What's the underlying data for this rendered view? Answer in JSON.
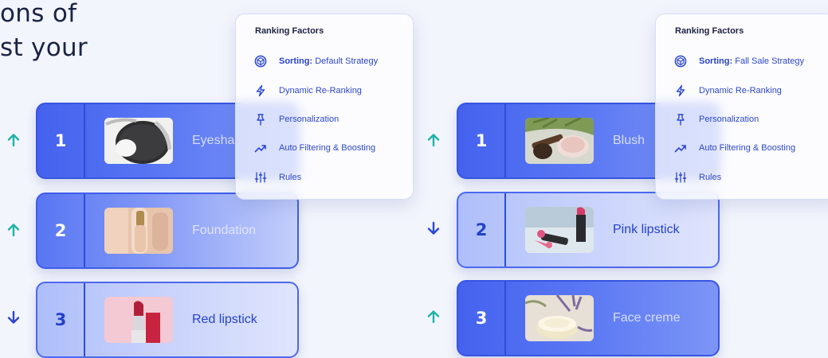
{
  "headline": {
    "line1": "ons of",
    "line2": "st your"
  },
  "colors": {
    "accent": "#3f5deb",
    "arrow_up": "#1fb3a8",
    "arrow_down": "#2a48d4"
  },
  "left_ranking": {
    "items": [
      {
        "rank": "1",
        "label": "Eyesha",
        "direction": "up",
        "image": "eyeshadow-compact"
      },
      {
        "rank": "2",
        "label": "Foundation",
        "direction": "up",
        "image": "foundation-bottle"
      },
      {
        "rank": "3",
        "label": "Red lipstick",
        "direction": "down",
        "image": "red-lipstick"
      }
    ],
    "panel": {
      "title": "Ranking Factors",
      "factors": [
        {
          "icon": "cube-icon",
          "bold": "Sorting:",
          "text": " Default Strategy"
        },
        {
          "icon": "lightning-icon",
          "bold": "",
          "text": "Dynamic Re-Ranking"
        },
        {
          "icon": "pin-icon",
          "bold": "",
          "text": "Personalization"
        },
        {
          "icon": "trend-icon",
          "bold": "",
          "text": "Auto Filtering & Boosting"
        },
        {
          "icon": "sliders-icon",
          "bold": "",
          "text": "Rules"
        }
      ]
    }
  },
  "right_ranking": {
    "items": [
      {
        "rank": "1",
        "label": "Blush",
        "direction": "up",
        "image": "blush-brush"
      },
      {
        "rank": "2",
        "label": "Pink lipstick",
        "direction": "down",
        "image": "pink-lipstick"
      },
      {
        "rank": "3",
        "label": "Face creme",
        "direction": "up",
        "image": "face-creme-jar"
      }
    ],
    "panel": {
      "title": "Ranking Factors",
      "factors": [
        {
          "icon": "cube-icon",
          "bold": "Sorting:",
          "text": " Fall Sale Strategy"
        },
        {
          "icon": "lightning-icon",
          "bold": "",
          "text": "Dynamic Re-Ranking"
        },
        {
          "icon": "pin-icon",
          "bold": "",
          "text": "Personalization"
        },
        {
          "icon": "trend-icon",
          "bold": "",
          "text": "Auto Filtering & Boosting"
        },
        {
          "icon": "sliders-icon",
          "bold": "",
          "text": "Rules"
        }
      ]
    }
  }
}
